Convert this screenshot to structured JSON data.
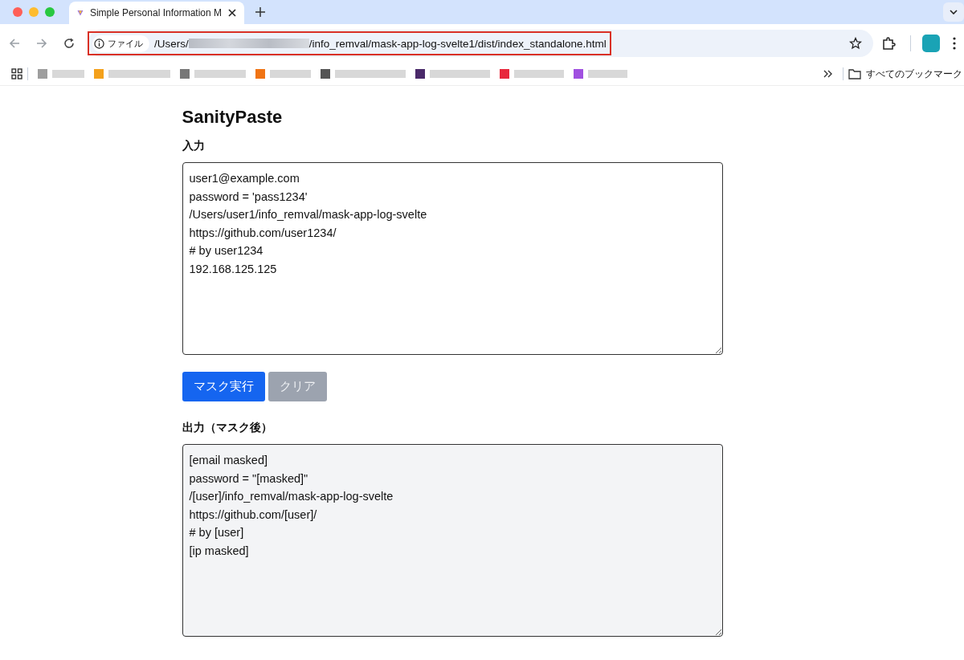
{
  "browser": {
    "tab": {
      "title": "Simple Personal Information M",
      "selected": true
    },
    "address": {
      "scheme_label": "ファイル",
      "path_start": "/Users/",
      "path_end": "/info_remval/mask-app-log-svelte1/dist/index_standalone.html",
      "highlighted": true
    },
    "bookmarks": [
      {
        "color": "#9e9e9e"
      },
      {
        "color": "#f4a11c"
      },
      {
        "color": "#777777"
      },
      {
        "color": "#f07414"
      },
      {
        "color": "#555555"
      },
      {
        "color": "#4a2a6a"
      },
      {
        "color": "#e8283c"
      },
      {
        "color": "#a050e0"
      }
    ],
    "all_bookmarks": "すべてのブックマーク"
  },
  "page": {
    "title": "SanityPaste",
    "input": {
      "label": "入力",
      "value": "user1@example.com\npassword = 'pass1234'\n/Users/user1/info_remval/mask-app-log-svelte\nhttps://github.com/user1234/\n# by user1234\n192.168.125.125"
    },
    "buttons": [
      {
        "label": "マスク実行",
        "disabled": false
      },
      {
        "label": "クリア",
        "disabled": true
      }
    ],
    "output": {
      "label": "出力（マスク後）",
      "value": "[email masked]\npassword = \"[masked]\"\n/[user]/info_remval/mask-app-log-svelte\nhttps://github.com/[user]/\n# by [user]\n[ip masked]",
      "readonly": true
    }
  }
}
